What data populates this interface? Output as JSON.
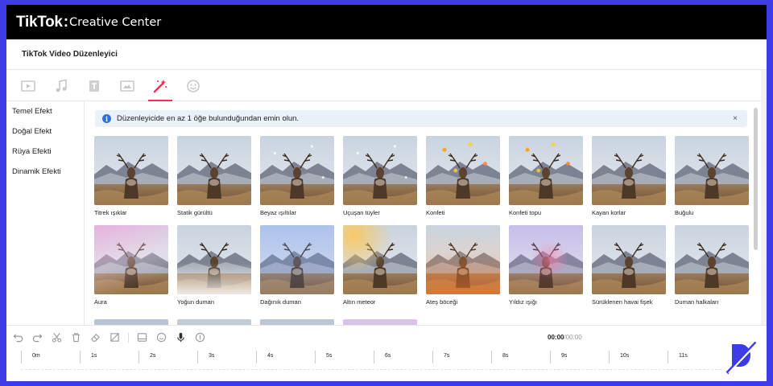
{
  "app": {
    "brand": "TikTok",
    "brand_suffix": "Creative Center",
    "page_title": "TikTok Video Düzenleyici"
  },
  "tabs": [
    {
      "icon": "video-icon",
      "active": false
    },
    {
      "icon": "music-icon",
      "active": false
    },
    {
      "icon": "text-icon",
      "active": false
    },
    {
      "icon": "transition-icon",
      "active": false
    },
    {
      "icon": "effects-wand-icon",
      "active": true
    },
    {
      "icon": "sticker-icon",
      "active": false
    }
  ],
  "sidebar": {
    "items": [
      {
        "label": "Temel Efekt",
        "active": true
      },
      {
        "label": "Doğal Efekt",
        "active": false
      },
      {
        "label": "Rüya Efekti",
        "active": false
      },
      {
        "label": "Dinamik Efekti",
        "active": false
      }
    ]
  },
  "alert": {
    "text": "Düzenleyicide en az 1 öğe bulunduğundan emin olun.",
    "close": "×"
  },
  "effects": [
    {
      "label": "Titrek ışıklar",
      "tint": "none"
    },
    {
      "label": "Statik gürültü",
      "tint": "none"
    },
    {
      "label": "Beyaz ışıltılar",
      "tint": "sparkle"
    },
    {
      "label": "Uçuşan tüyler",
      "tint": "sparkle"
    },
    {
      "label": "Konfeti",
      "tint": "confetti"
    },
    {
      "label": "Konfeti topu",
      "tint": "confetti"
    },
    {
      "label": "Kayan korlar",
      "tint": "none"
    },
    {
      "label": "Buğulu",
      "tint": "none"
    },
    {
      "label": "Aura",
      "tint": "aura"
    },
    {
      "label": "Yoğun duman",
      "tint": "smoke"
    },
    {
      "label": "Dağınık duman",
      "tint": "blue"
    },
    {
      "label": "Altın meteor",
      "tint": "gold"
    },
    {
      "label": "Ateş böceği",
      "tint": "fire"
    },
    {
      "label": "Yıldız ışığı",
      "tint": "star"
    },
    {
      "label": "Sürüklenen havai fişek",
      "tint": "none"
    },
    {
      "label": "Duman halkaları",
      "tint": "none"
    }
  ],
  "toolbar": {
    "icons": [
      "undo-icon",
      "redo-icon",
      "cut-icon",
      "delete-icon",
      "eraser-icon",
      "crop-icon",
      "caption-icon",
      "sticker-icon",
      "microphone-icon",
      "audio-icon"
    ]
  },
  "timeline": {
    "current": "00:00",
    "total": "/00:00",
    "ticks": [
      "0m",
      "1s",
      "2s",
      "3s",
      "4s",
      "5s",
      "6s",
      "7s",
      "8s",
      "9s",
      "10s",
      "11s"
    ]
  },
  "colors": {
    "accent": "#fe2c55",
    "border": "#3d3ce8",
    "info": "#2f6fe0"
  }
}
